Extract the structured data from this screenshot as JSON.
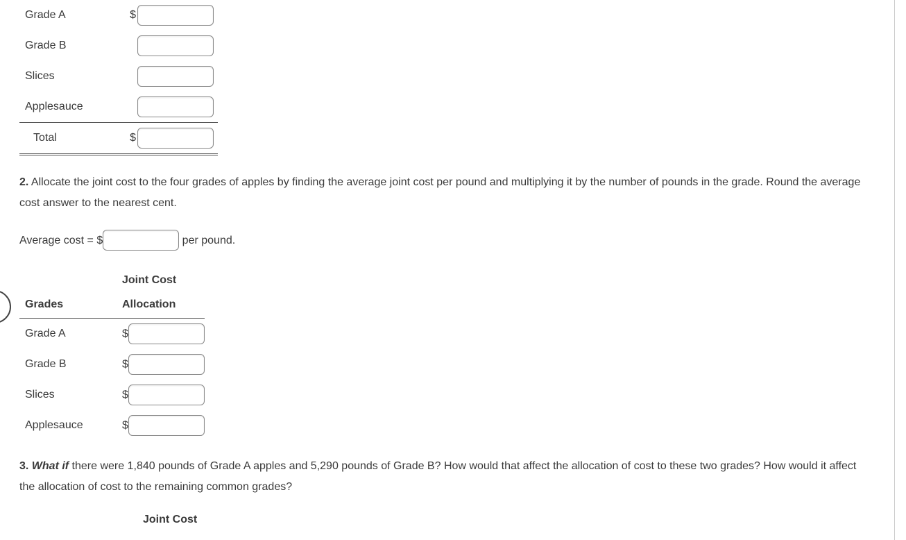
{
  "table1": {
    "rows": {
      "gradeA": "Grade A",
      "gradeB": "Grade B",
      "slices": "Slices",
      "applesauce": "Applesauce",
      "total": "Total"
    },
    "currency": "$"
  },
  "instruction2": {
    "num": "2.",
    "text": " Allocate the joint cost to the four grades of apples by finding the average joint cost per pound and multiplying it by the number of pounds in the grade. Round the average cost answer to the nearest cent."
  },
  "avg": {
    "prefix": "Average cost = $",
    "suffix": " per pound."
  },
  "table2": {
    "header_grades": "Grades",
    "header_joint1": "Joint Cost",
    "header_joint2": "Allocation",
    "rows": {
      "gradeA": "Grade A",
      "gradeB": "Grade B",
      "slices": "Slices",
      "applesauce": "Applesauce"
    },
    "currency": "$"
  },
  "instruction3": {
    "num": "3.",
    "whatif": " What if",
    "text": " there were 1,840 pounds of Grade A apples and 5,290 pounds of Grade B? How would that affect the allocation of cost to these two grades? How would it affect the allocation of cost to the remaining common grades?"
  },
  "bottom_header": "Joint Cost"
}
